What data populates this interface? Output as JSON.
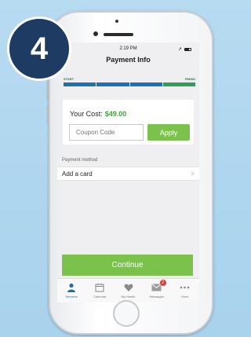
{
  "step_badge": {
    "number": "4"
  },
  "status_bar": {
    "time": "2:19 PM"
  },
  "nav": {
    "title": "Payment Info"
  },
  "progress": {
    "start_label": "START",
    "finish_label": "FINISH",
    "current_step": 4,
    "total_steps": 4,
    "colors": {
      "done": "#1f6fb4",
      "current": "#2f9e58",
      "track": "#cfd9e6"
    }
  },
  "cost": {
    "label": "Your Cost:",
    "value": "$49.00",
    "coupon_placeholder": "Coupon Code",
    "apply_label": "Apply"
  },
  "payment": {
    "section_label": "Payment method",
    "add_card_label": "Add a card",
    "chevron": ">"
  },
  "continue_label": "Continue",
  "tabs": [
    {
      "label": "Services",
      "icon": "person-icon",
      "active": true
    },
    {
      "label": "Calendar",
      "icon": "calendar-icon",
      "active": false
    },
    {
      "label": "My Health",
      "icon": "heart-icon",
      "active": false
    },
    {
      "label": "Messages",
      "icon": "envelope-icon",
      "active": false,
      "badge": "2"
    },
    {
      "label": "More",
      "icon": "more-dots-icon",
      "active": false
    }
  ],
  "colors": {
    "accent_green": "#7bc24c",
    "cost_green": "#3ea33e",
    "tab_active": "#1d6fb8",
    "badge_navy": "#1d3b63",
    "background_blue": "#b7dbf1"
  }
}
